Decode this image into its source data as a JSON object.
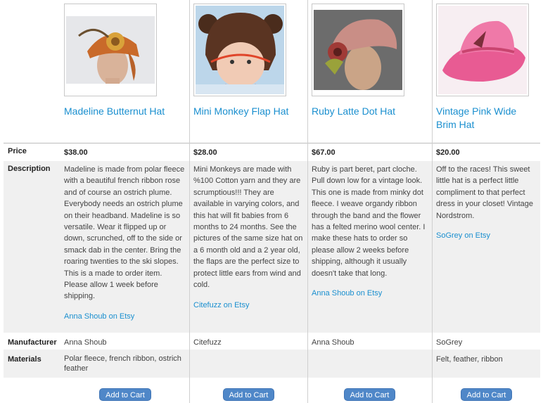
{
  "products": [
    {
      "name": "Madeline Butternut Hat",
      "image": "orange-felt-cloche-hat-on-mannequin",
      "price": "$38.00",
      "description": "Madeline is made from polar fleece with a beautiful french ribbon rose and of course an ostrich plume. Everybody needs an ostrich plume on their headband. Madeline is so versatile. Wear it flipped up or down, scrunched, off to the side or smack dab in the center. Bring the roaring twenties to the ski slopes. This is a made to order item. Please allow 1 week before shipping.",
      "seller_link": "Anna Shoub on Etsy",
      "manufacturer": "Anna Shoub",
      "materials": "Polar fleece, french ribbon, ostrich feather",
      "cart_label": "Add to Cart"
    },
    {
      "name": "Mini Monkey Flap Hat",
      "image": "brown-monkey-ear-baby-hat",
      "price": "$28.00",
      "description": "Mini Monkeys are made with %100 Cotton yarn and they are scrumptious!!! They are available in varying colors, and this hat will fit babies from 6 months to 24 months. See the pictures of the same size hat on a 6 month old and a 2 year old, the flaps are the perfect size to protect little ears from wind and cold.",
      "seller_link": "Citefuzz on Etsy",
      "manufacturer": "Citefuzz",
      "materials": "",
      "cart_label": "Add to Cart"
    },
    {
      "name": "Ruby Latte Dot Hat",
      "image": "pink-brown-beret-cloche-on-mannequin",
      "price": "$67.00",
      "description": "Ruby is part beret, part cloche. Pull down low for a vintage look. This one is made from minky dot fleece. I weave organdy ribbon through the band and the flower has a felted merino wool center. I make these hats to order so please allow 2 weeks before shipping, although it usually doesn't take that long.",
      "seller_link": "Anna Shoub on Etsy",
      "manufacturer": "Anna Shoub",
      "materials": "",
      "cart_label": "Add to Cart"
    },
    {
      "name": "Vintage Pink Wide Brim Hat",
      "image": "pink-wide-brim-felt-hat",
      "price": "$20.00",
      "description": "Off to the races!  This sweet little hat is a perfect little compliment to that perfect dress in your closet!  Vintage Nordstrom.",
      "seller_link": "SoGrey on Etsy",
      "manufacturer": "SoGrey",
      "materials": "Felt, feather, ribbon",
      "cart_label": "Add to Cart"
    }
  ],
  "labels": {
    "price": "Price",
    "description": "Description",
    "manufacturer": "Manufacturer",
    "materials": "Materials"
  },
  "colors": {
    "link": "#1a8fcf",
    "row_shade": "#f0f0f0",
    "button": "#4f87c8"
  }
}
